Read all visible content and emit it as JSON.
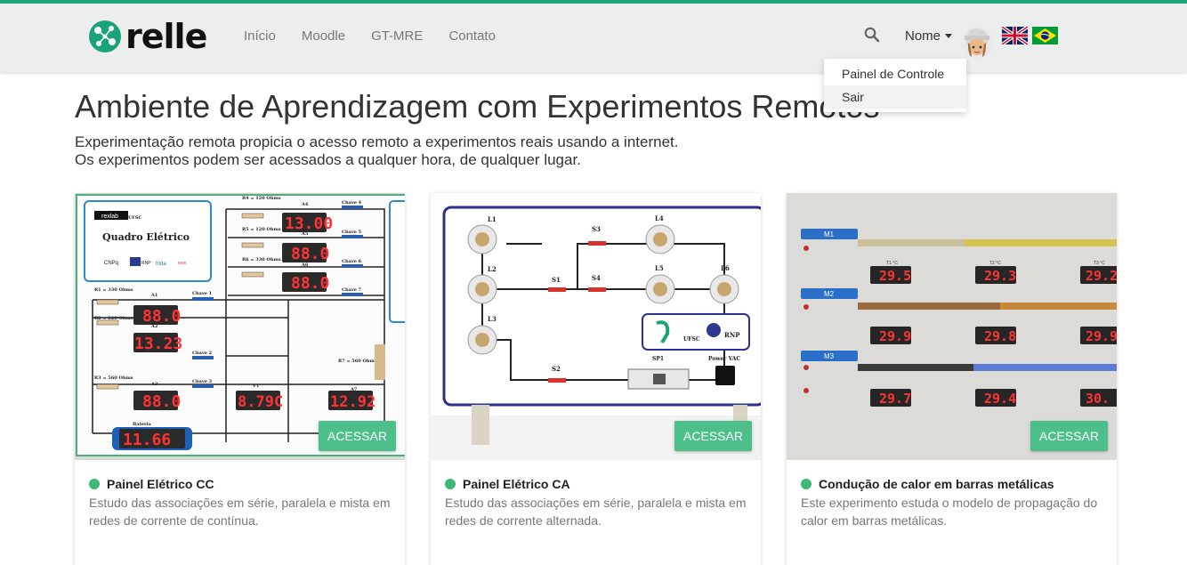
{
  "nav": {
    "logo_text": "relle",
    "links": [
      "Início",
      "Moodle",
      "GT-MRE",
      "Contato"
    ],
    "user_name": "Nome",
    "dropdown": [
      "Painel de Controle",
      "Sair"
    ]
  },
  "hero": {
    "title": "Ambiente de Aprendizagem com Experimentos Remotos",
    "subtitle_line1": "Experimentação remota propicia o acesso remoto a experimentos reais usando a internet.",
    "subtitle_line2": "Os experimentos podem ser acessados a qualquer hora, de qualquer lugar."
  },
  "cards": [
    {
      "title": "Painel Elétrico CC",
      "description": "Estudo das associações em série, paralela e mista em redes de corrente de contínua.",
      "button": "ACESSAR",
      "image": {
        "panel_title": "Quadro Elétrico",
        "logos": [
          "rexlab",
          "UFSC",
          "CNPq",
          "RNP",
          "frida",
          "ieee"
        ],
        "resistors": [
          "R4 = 120 Ohms",
          "R5 = 120 Ohms",
          "R6 = 330 Ohms",
          "R1 = 330 Ohms",
          "R2 = 220 Ohms",
          "R3 = 560 Ohms",
          "R7 = 560 Ohms"
        ],
        "meters": [
          "A4",
          "A5",
          "A6",
          "A1",
          "A2",
          "A3",
          "V1",
          "A7"
        ],
        "switches": [
          "Chave 4",
          "Chave 5",
          "Chave 6",
          "Chave 7",
          "Chave 1",
          "Chave 2",
          "Chave 3"
        ],
        "readings": [
          "13.00",
          "13.23",
          "8.79C",
          "12.92",
          "11.66"
        ],
        "battery_label": "Bateria"
      }
    },
    {
      "title": "Painel Elétrico CA",
      "description": "Estudo das associações em série, paralela e mista em redes de corrente alternada.",
      "button": "ACESSAR",
      "image": {
        "lamps": [
          "L1",
          "L2",
          "L3",
          "L4",
          "L5",
          "L6"
        ],
        "switches": [
          "S1",
          "S2",
          "S3",
          "S4",
          "SP1"
        ],
        "power_label": "Power VAC",
        "logos": [
          "UFSC",
          "RNP"
        ]
      }
    },
    {
      "title": "Condução de calor em barras metálicas",
      "description": "Este experimento estuda o modelo de propagação do calor em barras metálicas.",
      "button": "ACESSAR",
      "image": {
        "bars": [
          "M1",
          "M2",
          "M3"
        ],
        "sensor_labels": [
          "T1 °C",
          "T2 °C",
          "T3 °C"
        ],
        "readings": [
          "29.5",
          "29.3",
          "29.2",
          "29.9",
          "29.8",
          "29.9",
          "29.7",
          "29.4",
          "30."
        ]
      }
    }
  ],
  "colors": {
    "brand": "#1aa37a",
    "button": "#4dbf8a",
    "status": "#3cb878",
    "led": "#ff3333"
  },
  "icons": [
    "search-icon",
    "caret-down-icon",
    "avatar",
    "uk-flag-icon",
    "brazil-flag-icon",
    "status-dot-icon"
  ]
}
